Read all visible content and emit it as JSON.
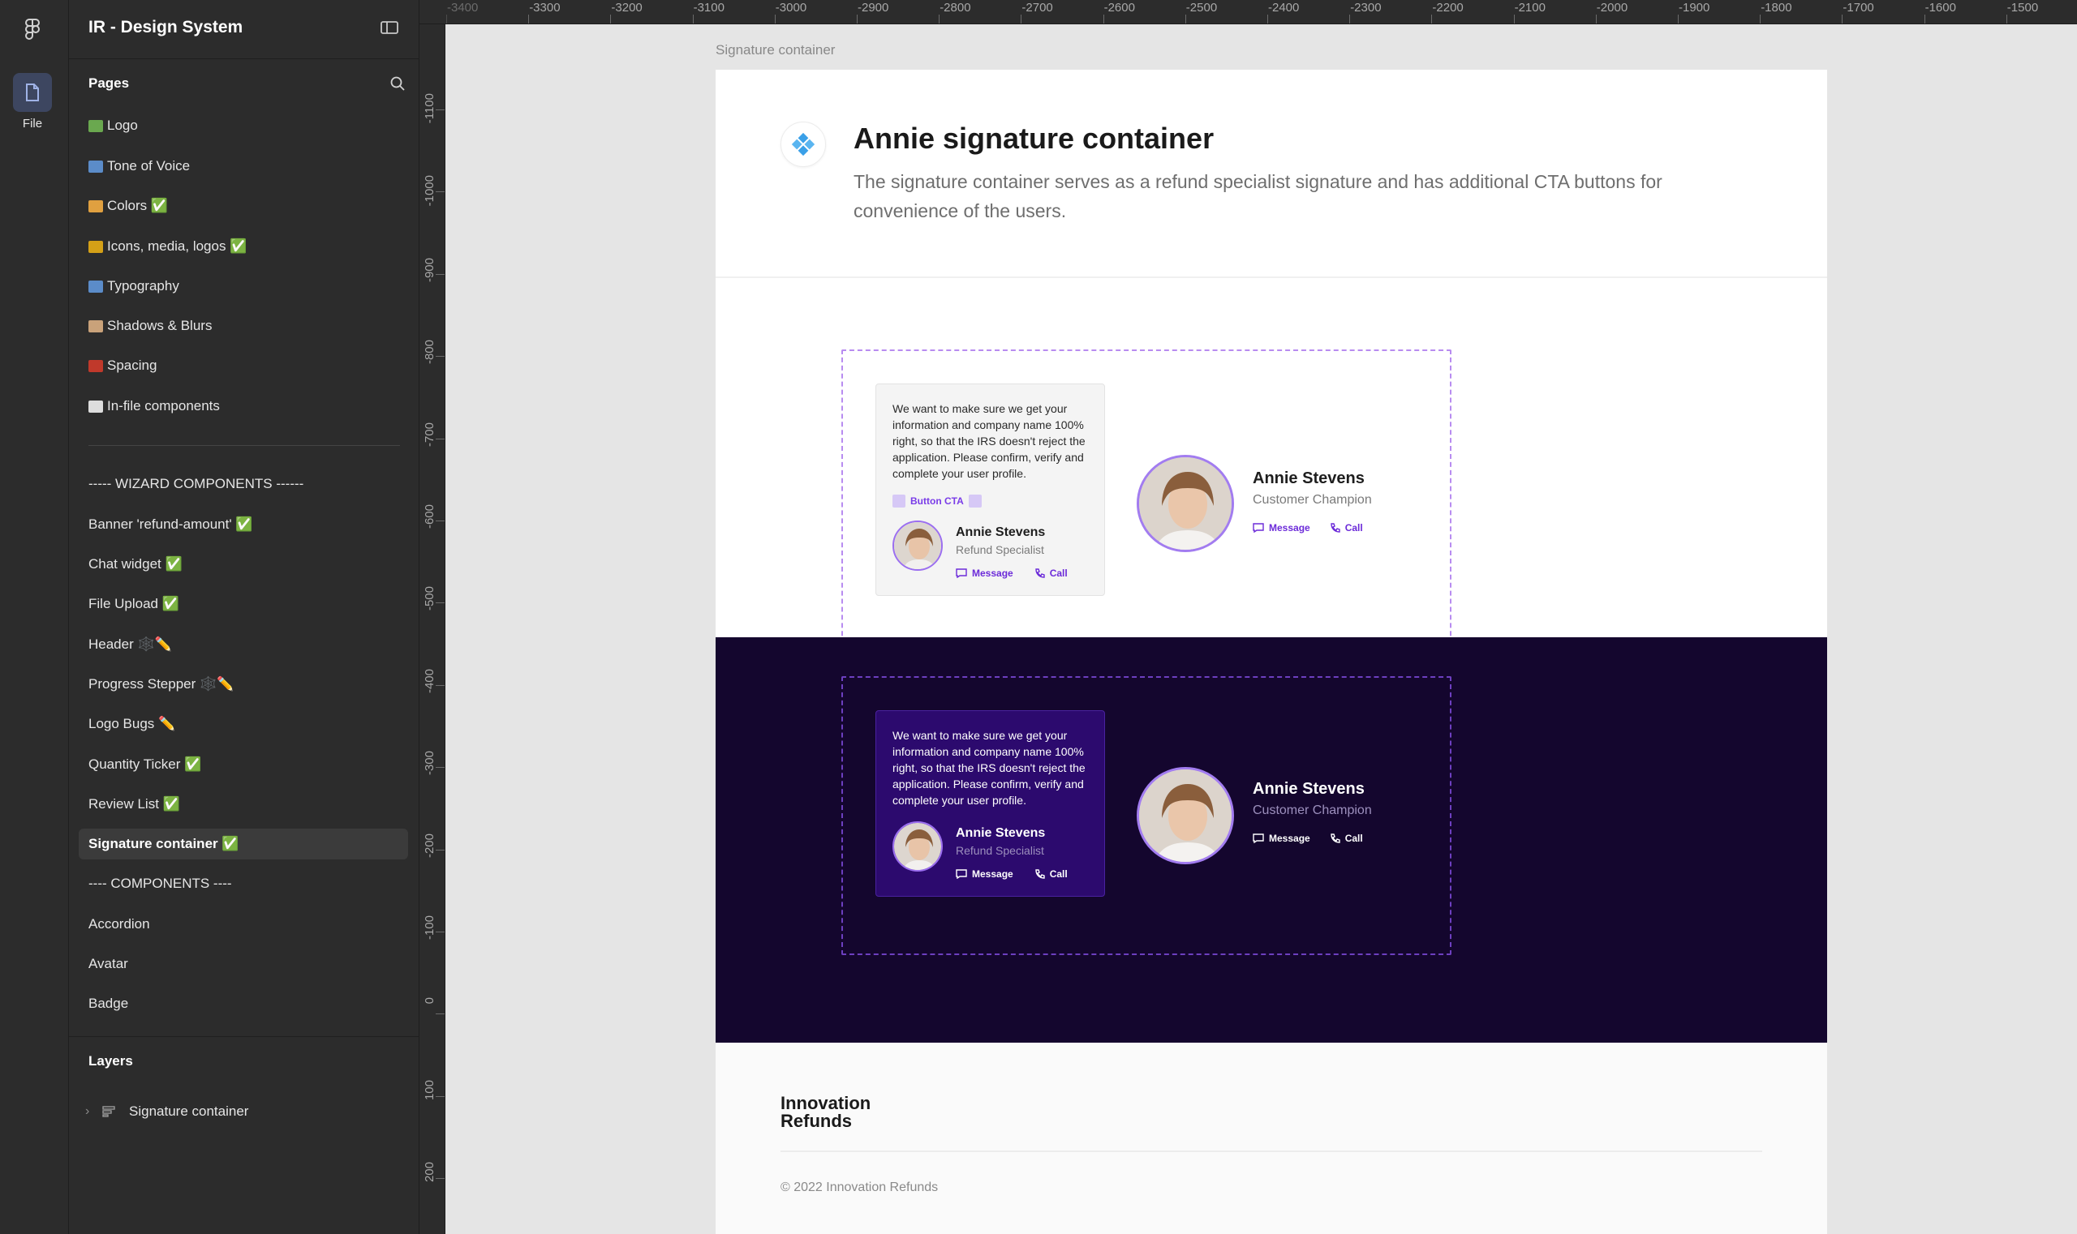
{
  "app": {
    "file_label": "File"
  },
  "sidebar": {
    "title": "IR - Design System",
    "pages_heading": "Pages",
    "layers_heading": "Layers",
    "pages": [
      {
        "label": "Logo",
        "emoji_color": "#6aa84f"
      },
      {
        "label": "Tone of Voice",
        "emoji_color": "#5b8cc9"
      },
      {
        "label": "Colors ✅",
        "emoji_color": "#e0a040"
      },
      {
        "label": "Icons, media, logos ✅",
        "emoji_color": "#d4a017"
      },
      {
        "label": "Typography",
        "emoji_color": "#5b8cc9"
      },
      {
        "label": "Shadows & Blurs",
        "emoji_color": "#c9a27a"
      },
      {
        "label": "Spacing",
        "emoji_color": "#c0392b"
      },
      {
        "label": "In-file components",
        "emoji_color": "#dddddd"
      },
      {
        "label": "----- WIZARD COMPONENTS ------"
      },
      {
        "label": "Banner 'refund-amount' ✅"
      },
      {
        "label": "Chat widget ✅"
      },
      {
        "label": "File Upload ✅"
      },
      {
        "label": "Header 🕸️✏️"
      },
      {
        "label": "Progress Stepper 🕸️✏️"
      },
      {
        "label": "Logo Bugs ✏️"
      },
      {
        "label": "Quantity Ticker ✅"
      },
      {
        "label": "Review List ✅"
      },
      {
        "label": "Signature container ✅"
      },
      {
        "label": "---- COMPONENTS ----"
      },
      {
        "label": "Accordion"
      },
      {
        "label": "Avatar"
      },
      {
        "label": "Badge"
      }
    ],
    "active_page": "Signature container ✅",
    "layers": [
      {
        "label": "Signature container"
      }
    ]
  },
  "rulers": {
    "top": [
      "-3400",
      "-3300",
      "-3200",
      "-3100",
      "-3000",
      "-2900",
      "-2800",
      "-2700",
      "-2600",
      "-2500",
      "-2400",
      "-2300",
      "-2200",
      "-2100",
      "-2000",
      "-1900",
      "-1800",
      "-1700",
      "-1600",
      "-1500"
    ],
    "left": [
      "-1100",
      "-1000",
      "-900",
      "-800",
      "-700",
      "-600",
      "-500",
      "-400",
      "-300",
      "-200",
      "-100",
      "0",
      "100",
      "200",
      "0"
    ]
  },
  "canvas": {
    "frame_label": "Signature container",
    "header": {
      "title": "Annie signature container",
      "description": "The signature container serves as a refund specialist signature and has additional CTA buttons for convenience of the users."
    },
    "card": {
      "text": "We want to make sure we get your information and company name 100% right, so that the IRS doesn't reject the application. Please confirm, verify and complete your user profile.",
      "button_cta": "Button CTA",
      "name": "Annie Stevens",
      "role": "Refund Specialist",
      "message": "Message",
      "call": "Call"
    },
    "profile": {
      "name": "Annie Stevens",
      "role": "Customer Champion",
      "message": "Message",
      "call": "Call"
    },
    "footer": {
      "logo": "Innovation Refunds",
      "copyright": "© 2022 Innovation Refunds"
    }
  },
  "colors": {
    "accent": "#6c2bd9",
    "dark_bg": "#14062e",
    "card_dark": "#2c0a6e",
    "dash": "#b88cf0"
  }
}
